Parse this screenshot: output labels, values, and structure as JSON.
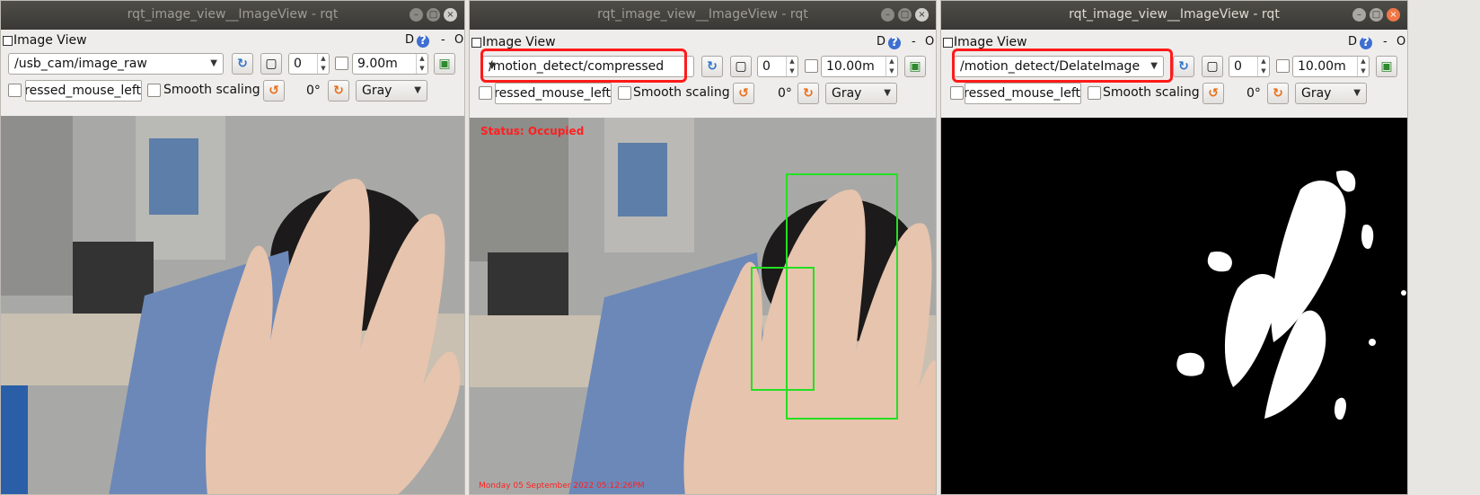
{
  "windows": [
    {
      "title": "rqt_image_view__ImageView - rqt",
      "dock_title": "Image View",
      "topic": "/usb_cam/image_raw",
      "spin_value": "0",
      "time_value": "9.00m",
      "mouse_topic": "pressed_mouse_left",
      "smooth_label": "Smooth scaling",
      "rotation": "0°",
      "color_scheme": "Gray",
      "d_label": "D",
      "help_label": "?",
      "dash_label": "-",
      "o_label": "O"
    },
    {
      "title": "rqt_image_view__ImageView - rqt",
      "dock_title": "Image View",
      "topic": "/motion_detect/compressed",
      "spin_value": "0",
      "time_value": "10.00m",
      "mouse_topic": "pressed_mouse_left",
      "smooth_label": "Smooth scaling",
      "rotation": "0°",
      "color_scheme": "Gray",
      "d_label": "D",
      "help_label": "?",
      "dash_label": "-",
      "o_label": "O",
      "overlay_status": "Status: Occupied",
      "overlay_timestamp": "Monday 05 September 2022 05:12:26PM"
    },
    {
      "title": "rqt_image_view__ImageView - rqt",
      "dock_title": "Image View",
      "topic": "/motion_detect/DelateImage/compressed",
      "spin_value": "0",
      "time_value": "10.00m",
      "mouse_topic": "pressed_mouse_left",
      "smooth_label": "Smooth scaling",
      "rotation": "0°",
      "color_scheme": "Gray",
      "d_label": "D",
      "help_label": "?",
      "dash_label": "-",
      "o_label": "O"
    }
  ],
  "window_buttons": {
    "minimize": "–",
    "maximize": "□",
    "close": "×"
  },
  "colors": {
    "highlight": "#ff1a1a",
    "bbox": "#22e022",
    "status_text": "#ff2020"
  },
  "icons": {
    "refresh": "refresh-icon",
    "save": "save-image-icon",
    "rotate_left": "rotate-left-icon",
    "rotate_right": "rotate-right-icon",
    "zoom_fit": "zoom-fit-icon"
  }
}
